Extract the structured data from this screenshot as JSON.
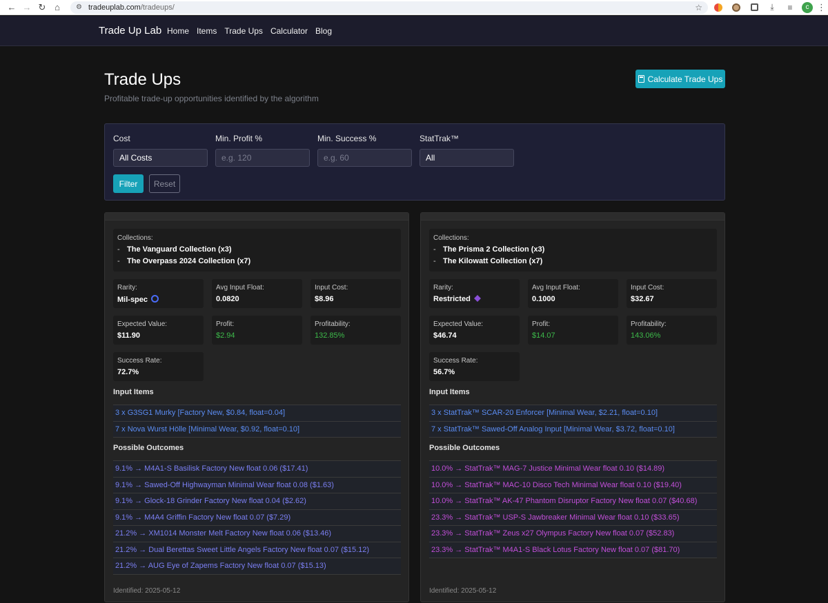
{
  "browser": {
    "url_domain": "tradeuplab.com",
    "url_path": "/tradeups/",
    "profile_initial": "c"
  },
  "nav": {
    "brand": "Trade Up Lab",
    "links": [
      "Home",
      "Items",
      "Trade Ups",
      "Calculator",
      "Blog"
    ]
  },
  "header": {
    "title": "Trade Ups",
    "subtitle": "Profitable trade-up opportunities identified by the algorithm",
    "calc_button": "Calculate Trade Ups"
  },
  "filters": {
    "cost_label": "Cost",
    "cost_value": "All Costs",
    "profit_label": "Min. Profit %",
    "profit_placeholder": "e.g. 120",
    "success_label": "Min. Success %",
    "success_placeholder": "e.g. 60",
    "stattrak_label": "StatTrak™",
    "stattrak_value": "All",
    "filter_button": "Filter",
    "reset_button": "Reset"
  },
  "labels": {
    "collections": "Collections:",
    "rarity": "Rarity:",
    "avg_float": "Avg Input Float:",
    "input_cost": "Input Cost:",
    "expected_value": "Expected Value:",
    "profit": "Profit:",
    "profitability": "Profitability:",
    "success_rate": "Success Rate:",
    "input_items": "Input Items",
    "possible_outcomes": "Possible Outcomes"
  },
  "cards": [
    {
      "collections": [
        "The Vanguard Collection (x3)",
        "The Overpass 2024 Collection (x7)"
      ],
      "rarity": "Mil-spec",
      "avg_float": "0.0820",
      "input_cost": "$8.96",
      "expected_value": "$11.90",
      "profit": "$2.94",
      "profitability": "132.85%",
      "success_rate": "72.7%",
      "inputs": [
        "3 x G3SG1 Murky [Factory New, $0.84, float=0.04]",
        "7 x Nova Wurst Hölle [Minimal Wear, $0.92, float=0.10]"
      ],
      "outcomes": [
        "9.1% → M4A1-S Basilisk Factory New float 0.06 ($17.41)",
        "9.1% → Sawed-Off Highwayman Minimal Wear float 0.08 ($1.63)",
        "9.1% → Glock-18 Grinder Factory New float 0.04 ($2.62)",
        "9.1% → M4A4 Griffin Factory New float 0.07 ($7.29)",
        "21.2% → XM1014 Monster Melt Factory New float 0.06 ($13.46)",
        "21.2% → Dual Berettas Sweet Little Angels Factory New float 0.07 ($15.12)",
        "21.2% → AUG Eye of Zapems Factory New float 0.07 ($15.13)"
      ],
      "identified": "Identified: 2025-05-12"
    },
    {
      "collections": [
        "The Prisma 2 Collection (x3)",
        "The Kilowatt Collection (x7)"
      ],
      "rarity": "Restricted",
      "avg_float": "0.1000",
      "input_cost": "$32.67",
      "expected_value": "$46.74",
      "profit": "$14.07",
      "profitability": "143.06%",
      "success_rate": "56.7%",
      "inputs": [
        "3 x StatTrak™ SCAR-20 Enforcer [Minimal Wear, $2.21, float=0.10]",
        "7 x StatTrak™ Sawed-Off Analog Input [Minimal Wear, $3.72, float=0.10]"
      ],
      "outcomes": [
        "10.0% → StatTrak™ MAG-7 Justice Minimal Wear float 0.10 ($14.89)",
        "10.0% → StatTrak™ MAC-10 Disco Tech Minimal Wear float 0.10 ($19.40)",
        "10.0% → StatTrak™ AK-47 Phantom Disruptor Factory New float 0.07 ($40.68)",
        "23.3% → StatTrak™ USP-S Jawbreaker Minimal Wear float 0.10 ($33.65)",
        "23.3% → StatTrak™ Zeus x27 Olympus Factory New float 0.07 ($52.83)",
        "23.3% → StatTrak™ M4A1-S Black Lotus Factory New float 0.07 ($81.70)"
      ],
      "identified": "Identified: 2025-05-12"
    }
  ]
}
